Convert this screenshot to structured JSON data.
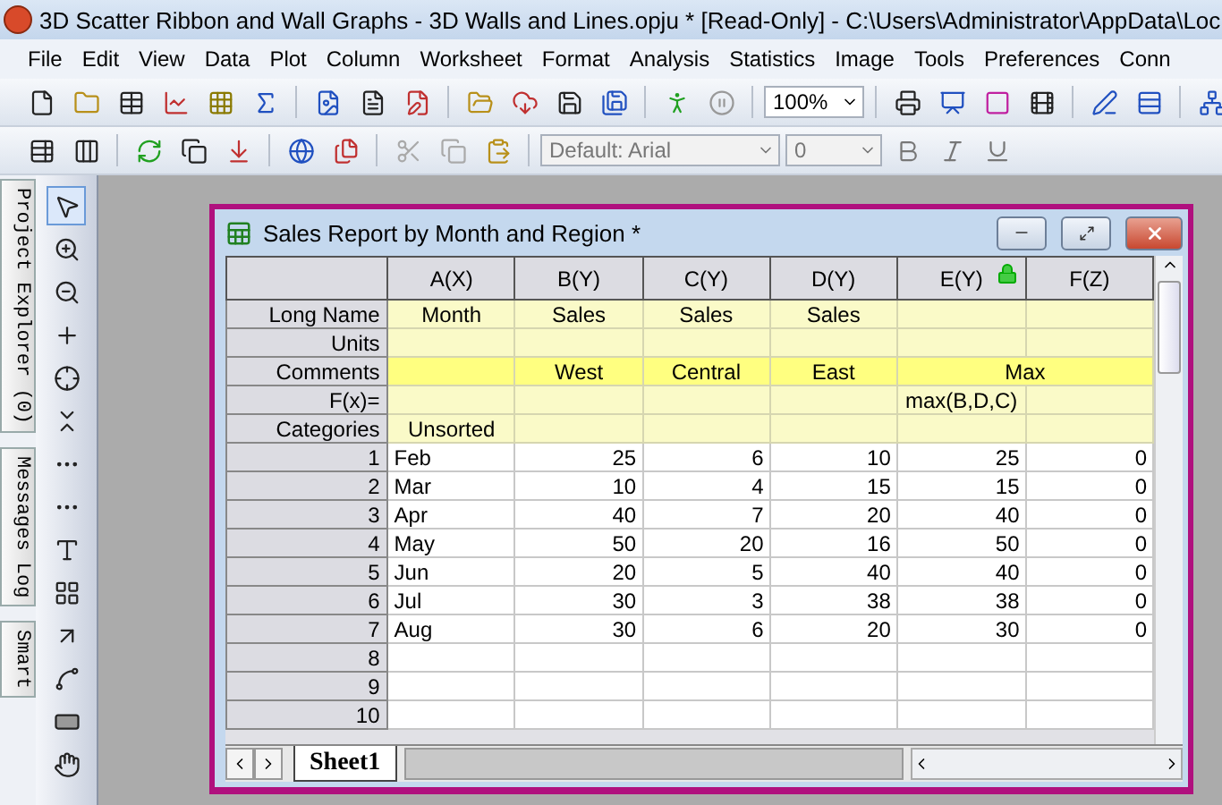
{
  "window": {
    "title": "3D Scatter Ribbon and Wall Graphs - 3D Walls and Lines.opju * [Read-Only] - C:\\Users\\Administrator\\AppData\\Loc"
  },
  "menu": [
    "File",
    "Edit",
    "View",
    "Data",
    "Plot",
    "Column",
    "Worksheet",
    "Format",
    "Analysis",
    "Statistics",
    "Image",
    "Tools",
    "Preferences",
    "Conn"
  ],
  "toolbar": {
    "zoom": "100%",
    "font": "Default: Arial",
    "font_size": "0"
  },
  "dock_tabs": [
    "Project Explorer (0)",
    "Messages Log",
    "Smart"
  ],
  "worksheet": {
    "title": "Sales Report by Month and Region *",
    "columns": [
      {
        "label": "A(X)",
        "locked": false
      },
      {
        "label": "B(Y)",
        "locked": false
      },
      {
        "label": "C(Y)",
        "locked": false
      },
      {
        "label": "D(Y)",
        "locked": false
      },
      {
        "label": "E(Y)",
        "locked": true
      },
      {
        "label": "F(Z)",
        "locked": false
      }
    ],
    "label_rows": [
      {
        "label": "Long Name",
        "highlighted": false,
        "cells": [
          {
            "text": "Month"
          },
          {
            "text": "Sales"
          },
          {
            "text": "Sales"
          },
          {
            "text": "Sales"
          },
          {},
          {}
        ]
      },
      {
        "label": "Units",
        "highlighted": false,
        "cells": [
          {},
          {},
          {},
          {},
          {},
          {}
        ]
      },
      {
        "label": "Comments",
        "highlighted": true,
        "cells": [
          {},
          {
            "text": "West"
          },
          {
            "text": "Central"
          },
          {
            "text": "East"
          },
          {
            "text": "Max",
            "spans_next": true
          }
        ]
      },
      {
        "label": "F(x)=",
        "highlighted": false,
        "cells": [
          {},
          {},
          {},
          {},
          {
            "text": "max(B,D,C)"
          },
          {}
        ]
      },
      {
        "label": "Categories",
        "highlighted": false,
        "cells": [
          {
            "text": "Unsorted"
          },
          {},
          {},
          {},
          {},
          {}
        ]
      }
    ],
    "rows": [
      {
        "row": "1",
        "cells": [
          "Feb",
          "25",
          "6",
          "10",
          "25",
          "0"
        ]
      },
      {
        "row": "2",
        "cells": [
          "Mar",
          "10",
          "4",
          "15",
          "15",
          "0"
        ]
      },
      {
        "row": "3",
        "cells": [
          "Apr",
          "40",
          "7",
          "20",
          "40",
          "0"
        ]
      },
      {
        "row": "4",
        "cells": [
          "May",
          "50",
          "20",
          "16",
          "50",
          "0"
        ]
      },
      {
        "row": "5",
        "cells": [
          "Jun",
          "20",
          "5",
          "40",
          "40",
          "0"
        ]
      },
      {
        "row": "6",
        "cells": [
          "Jul",
          "30",
          "3",
          "38",
          "38",
          "0"
        ]
      },
      {
        "row": "7",
        "cells": [
          "Aug",
          "30",
          "6",
          "20",
          "30",
          "0"
        ]
      },
      {
        "row": "8",
        "cells": []
      },
      {
        "row": "9",
        "cells": []
      },
      {
        "row": "10",
        "cells": []
      }
    ],
    "sheet_tabs": [
      {
        "label": "Sheet1",
        "selected": true
      }
    ]
  }
}
